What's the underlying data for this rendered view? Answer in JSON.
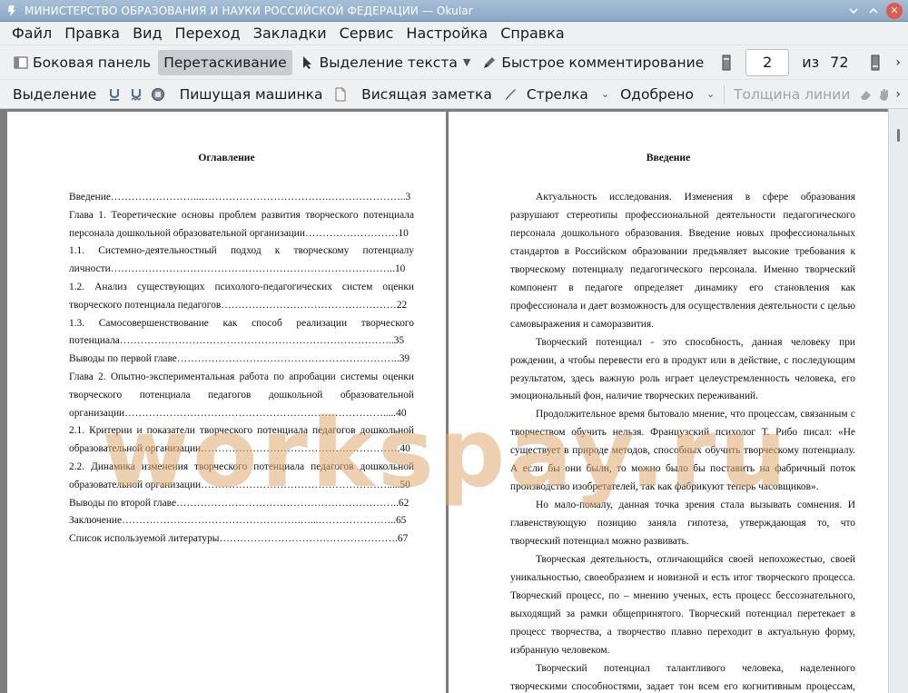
{
  "window": {
    "title": "МИНИСТЕРСТВО ОБРАЗОВАНИЯ И НАУКИ РОССИЙСКОЙ ФЕДЕРАЦИИ  — Okular"
  },
  "menu": [
    "Файл",
    "Правка",
    "Вид",
    "Переход",
    "Закладки",
    "Сервис",
    "Настройка",
    "Справка"
  ],
  "toolbar1": {
    "sidebar": "Боковая панель",
    "drag": "Перетаскивание",
    "text_select": "Выделение текста",
    "quick_comment": "Быстрое комментирование",
    "page_current": "2",
    "page_of": "из",
    "page_total": "72"
  },
  "toolbar2": {
    "highlight": "Выделение",
    "typewriter": "Пишущая машинка",
    "sticky_note": "Висящая заметка",
    "arrow": "Стрелка",
    "approved": "Одобрено",
    "line_width": "Толщина линии"
  },
  "watermark": "workspay.ru",
  "left_page": {
    "heading": "Оглавление",
    "lines": [
      "Введение……………………...……………………………….…………………..3",
      "Глава 1. Теоретические основы проблем развития творческого потенциала",
      "персонала дошкольной образовательной организации………………………10",
      "1.1. Системно-деятельностный подход к творческому потенциалу",
      "личности………………………………………………………………………..10",
      "1.2. Анализ существующих психолого-педагогических систем оценки",
      "творческого потенциала педагогов……………………………………………22",
      "1.3. Самосовершенствование как способ реализации творческого",
      "потенциала……………………………………………………………………..35",
      "Выводы по первой главе………………………………………………………..39",
      "Глава 2. Опытно-экспериментальная работа по апробации системы оценки",
      "творческого потенциала педагогов дошкольной образовательной",
      "организации………………………………………………………………….....40",
      "2.1. Критерии и показатели творческого потенциала педагогов дошкольной",
      "образовательной организации………………………………………………….40",
      "2.2. Динамика изменения творческого потенциала педагогов дошкольной",
      "образовательной организации……………………………………………….....50",
      "Выводы по второй главе………………………………………………………..62",
      "Заключение…………………………………………….…...…………………..65",
      "Список используемой литературы…………………………………………….67"
    ]
  },
  "right_page": {
    "heading": "Введение",
    "lines": [
      "Актуальность исследования. Изменения в сфере образования",
      "разрушают стереотипы профессиональной деятельности педагогического",
      "персонала дошкольного образования. Введение новых профессиональных",
      "стандартов в Российском образовании предъявляет высокие требования к",
      "творческому потенциалу педагогического персонала. Именно творческий",
      "компонент в педагоге определяет динамику его становления как",
      "профессионала и дает возможность для осуществления деятельности с целью",
      "самовыражения и саморазвития.",
      "Творческий потенциал - это способность, данная человеку при",
      "рождении, а чтобы перевести его в продукт или в действие, с последующим",
      "результатом, здесь важную роль играет целеустремленность человека, его",
      "эмоциональный фон, наличие творческих переживаний.",
      "Продолжительное время бытовало мнение, что процессам, связанным с",
      "творчеством обучить нельзя. Французский психолог Т. Рибо писал: «Не",
      "существует в природе методов, способных обучить творческому потенциалу.",
      "А если бы они были, то можно было бы поставить на фабричный поток",
      "производство изобретателей, так как фабрикуют теперь часовщиков».",
      "Но мало-помалу, данная точка зрения стала вызывать сомнения. И",
      "главенствующую позицию заняла гипотеза, утверждающая то, что",
      "творческий потенциал можно развивать.",
      "Творческая деятельность, отличающийся своей непохожестью, своей",
      "уникальностью, своеобразием и новизной и есть итог творческого процесса.",
      "Творческий процесс, по – мнению ученых, есть процесс бессознательного,",
      "выходящий за рамки общепринятого. Творческий потенциал перетекает в",
      "процесс творчества, а творчество плавно переходит в актуальную форму,",
      "избранную человеком.",
      "Творческий потенциал талантливого человека, наделенного",
      "творческими способностями, задает тон всем его когнитивным процессам,"
    ]
  }
}
